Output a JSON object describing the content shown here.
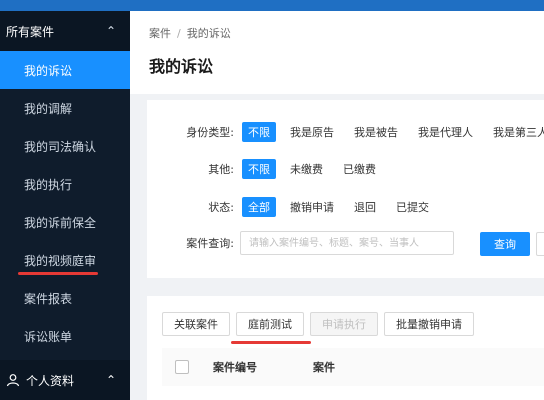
{
  "colors": {
    "sidebar_bg": "#0f1c2c",
    "accent": "#1890ff",
    "underline": "#e53935"
  },
  "sidebar": {
    "section_title": "所有案件",
    "section_icon": "chevron-up-icon",
    "items": [
      {
        "label": "我的诉讼",
        "active": true
      },
      {
        "label": "我的调解"
      },
      {
        "label": "我的司法确认"
      },
      {
        "label": "我的执行"
      },
      {
        "label": "我的诉前保全"
      },
      {
        "label": "我的视频庭审",
        "underlined": true
      },
      {
        "label": "案件报表"
      },
      {
        "label": "诉讼账单"
      }
    ],
    "bottom": {
      "label": "个人资料",
      "icon": "user-icon"
    }
  },
  "breadcrumb": {
    "root": "案件",
    "separator": "/",
    "current": "我的诉讼"
  },
  "page_title": "我的诉讼",
  "filters": {
    "identity": {
      "label": "身份类型:",
      "options": [
        "不限",
        "我是原告",
        "我是被告",
        "我是代理人",
        "我是第三人"
      ],
      "selected": "不限"
    },
    "other": {
      "label": "其他:",
      "options": [
        "不限",
        "未缴费",
        "已缴费"
      ],
      "selected": "不限"
    },
    "status": {
      "label": "状态:",
      "options": [
        "全部",
        "撤销申请",
        "退回",
        "已提交"
      ],
      "selected": "全部"
    },
    "search": {
      "label": "案件查询:",
      "placeholder": "请输入案件编号、标题、案号、当事人",
      "button": "查询"
    }
  },
  "actions": [
    "关联案件",
    "庭前测试",
    "申请执行",
    "批量撤销申请"
  ],
  "table": {
    "columns": [
      "案件编号",
      "案件"
    ]
  }
}
